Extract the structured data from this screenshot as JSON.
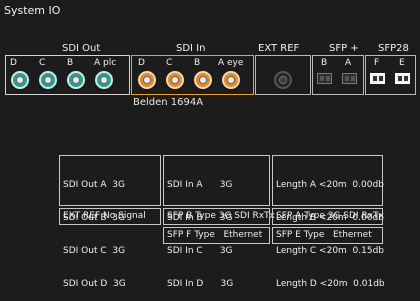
{
  "window": {
    "title": "System IO"
  },
  "groups": {
    "sdi_out": {
      "label": "SDI Out",
      "ports": [
        "D",
        "C",
        "B",
        "A plc"
      ]
    },
    "sdi_in": {
      "label": "SDI In",
      "ports": [
        "D",
        "C",
        "B",
        "A eye"
      ]
    },
    "ext_ref": {
      "label": "EXT REF"
    },
    "sfp_plus": {
      "label": "SFP +",
      "ports": [
        "B",
        "A"
      ]
    },
    "sfp28": {
      "label": "SFP28",
      "ports": [
        "F",
        "E"
      ]
    }
  },
  "cable_label": "Belden 1694A",
  "status": {
    "sdi_out": [
      "SDI Out A  3G",
      "SDI Out B  3G",
      "SDI Out C  3G",
      "SDI Out D  3G"
    ],
    "sdi_in": [
      "SDI In A      3G",
      "SDI In B      3G",
      "SDI In C      3G",
      "SDI In D      3G"
    ],
    "length": [
      "Length A <20m  0.00db",
      "Length B <20m  0.00db",
      "Length C <20m  0.15db",
      "Length D <20m  0.01db"
    ],
    "ext_ref": "EXT REF No Signal",
    "sfp_b": "SFP B Type 3G SDI RxTx",
    "sfp_a": "SFP A Type 3G SDI RxTx",
    "sfp_f": "SFP F Type   Ethernet",
    "sfp_e": "SFP E Type   Ethernet"
  },
  "colors": {
    "sdi_out_connector": "#2e9c90",
    "sdi_in_connector": "#e08a2a",
    "sdi_in_border": "#e8a03a",
    "background": "#1c1c1c"
  }
}
